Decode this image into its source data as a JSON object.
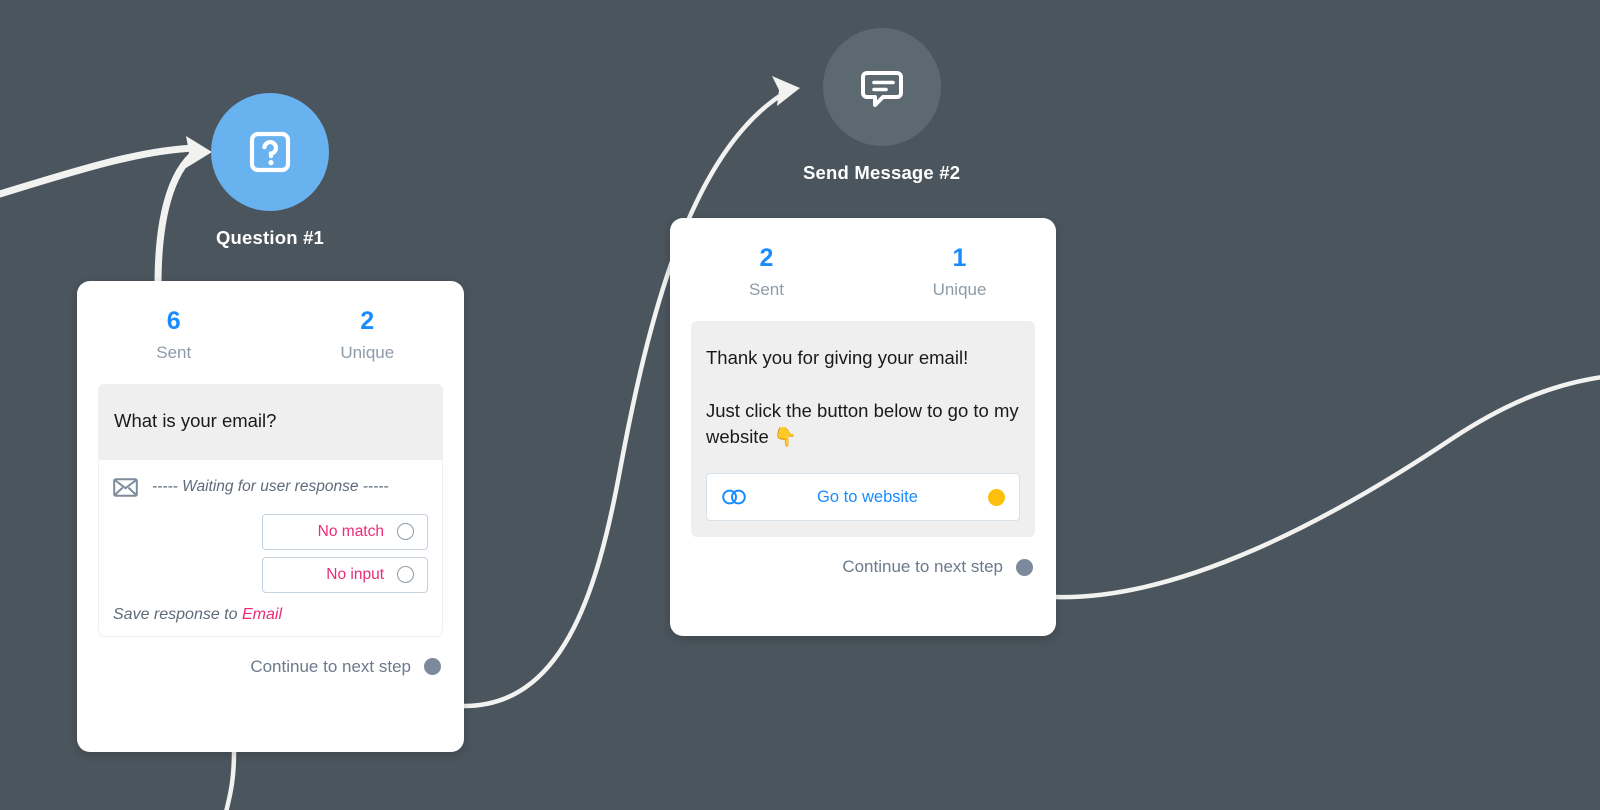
{
  "canvas": {
    "background_color": "#4b555d",
    "connector_color": "#f2f2f0"
  },
  "colors": {
    "accent_blue": "#1a8cff",
    "node_question": "#68b2f0",
    "node_message": "#5d6971",
    "pink": "#ec2c77",
    "yellow_dot": "#fcc00c",
    "slate_dot": "#7c8a9c",
    "muted_text": "#8e9ba8"
  },
  "nodes": [
    {
      "id": "question-1",
      "title": "Question #1",
      "icon": "question-mark-box-icon",
      "stats": [
        {
          "value": "6",
          "label": "Sent"
        },
        {
          "value": "2",
          "label": "Unique"
        }
      ],
      "question_text": "What is your email?",
      "waiting_icon": "envelope-icon",
      "waiting_text": "----- Waiting for user response -----",
      "options": [
        {
          "label": "No match",
          "connector": "hollow-circle"
        },
        {
          "label": "No input",
          "connector": "hollow-circle"
        }
      ],
      "save_prefix": "Save response to",
      "save_target": "Email",
      "continue_label": "Continue to next step"
    },
    {
      "id": "send-message-2",
      "title": "Send Message #2",
      "icon": "chat-bubble-icon",
      "stats": [
        {
          "value": "2",
          "label": "Sent"
        },
        {
          "value": "1",
          "label": "Unique"
        }
      ],
      "message_lines": [
        "Thank you for giving your email!",
        "Just click the button below to go to my website 👇"
      ],
      "link_button": {
        "icon": "chain-link-icon",
        "label": "Go to website",
        "connector": "yellow-dot"
      },
      "continue_label": "Continue to next step"
    }
  ]
}
